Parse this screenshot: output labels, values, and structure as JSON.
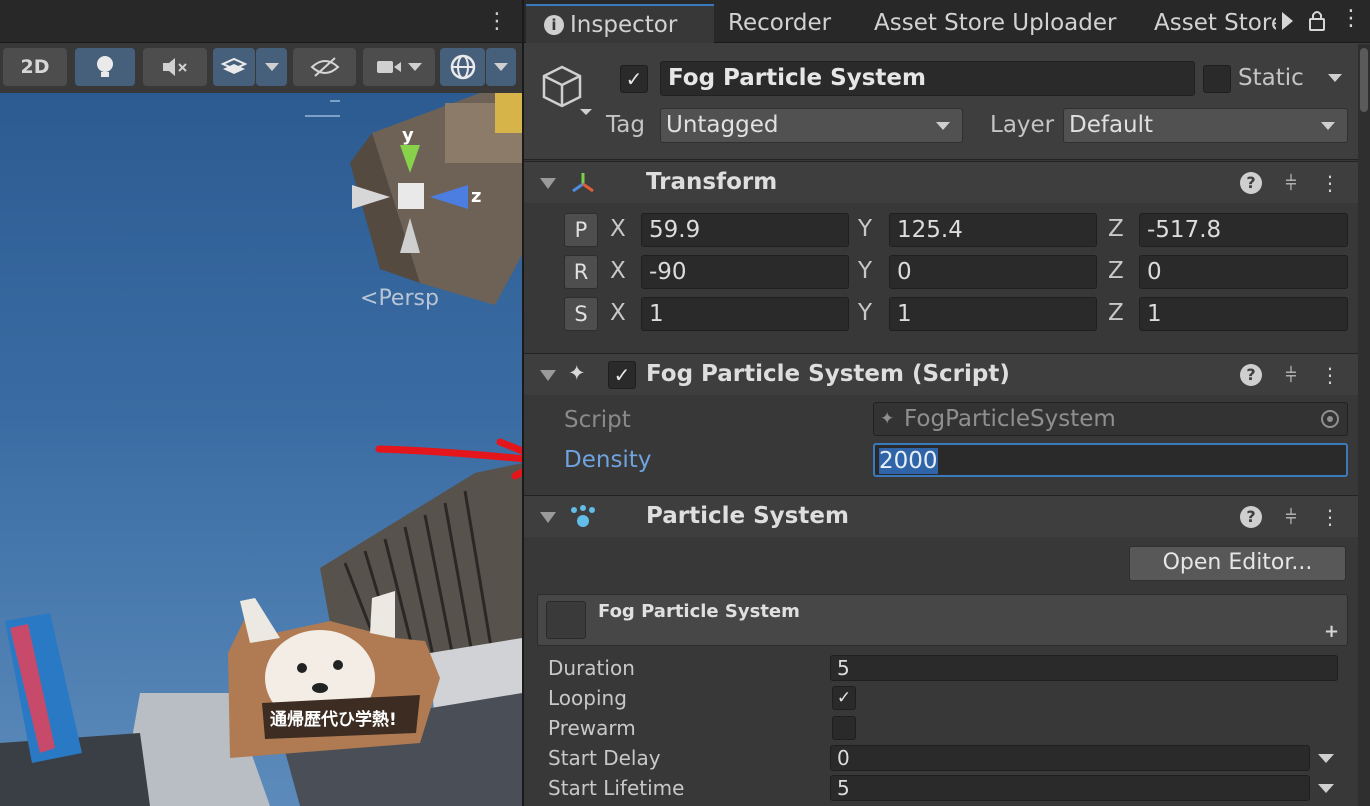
{
  "scene": {
    "toolbar": {
      "toggle_2d_label": "2D",
      "buttons": [
        "lighting-icon",
        "audio-mute-icon",
        "effects-icon",
        "visibility-icon",
        "camera-icon",
        "gizmos-icon"
      ]
    },
    "gizmo_axes": {
      "y": "y",
      "z": "z"
    },
    "perspective_label": "Persp",
    "billboard_text": "通帰歴代ひ学熱!"
  },
  "inspector": {
    "tabs": [
      {
        "label": "Inspector",
        "active": true
      },
      {
        "label": "Recorder"
      },
      {
        "label": "Asset Store Uploader"
      },
      {
        "label": "Asset Store"
      }
    ],
    "gameobject": {
      "active": true,
      "name": "Fog Particle System",
      "static_label": "Static",
      "tag_label": "Tag",
      "tag_value": "Untagged",
      "layer_label": "Layer",
      "layer_value": "Default"
    },
    "transform": {
      "title": "Transform",
      "position": {
        "button": "P",
        "x": "59.9",
        "y": "125.4",
        "z": "-517.8"
      },
      "rotation": {
        "button": "R",
        "x": "-90",
        "y": "0",
        "z": "0"
      },
      "scale": {
        "button": "S",
        "x": "1",
        "y": "1",
        "z": "1"
      },
      "axis_labels": {
        "x": "X",
        "y": "Y",
        "z": "Z"
      }
    },
    "script_component": {
      "title": "Fog Particle System (Script)",
      "enabled": true,
      "script_label": "Script",
      "script_value": "FogParticleSystem",
      "density_label": "Density",
      "density_value": "2000"
    },
    "particle_system": {
      "title": "Particle System",
      "open_editor_label": "Open Editor...",
      "module_title": "Fog Particle System",
      "fields": {
        "duration_label": "Duration",
        "duration_value": "5",
        "looping_label": "Looping",
        "looping_checked": true,
        "prewarm_label": "Prewarm",
        "prewarm_checked": false,
        "start_delay_label": "Start Delay",
        "start_delay_value": "0",
        "start_lifetime_label": "Start Lifetime",
        "start_lifetime_value": "5"
      }
    }
  },
  "colors": {
    "inspector_bg": "#383838",
    "header_bg": "#3e3e3e",
    "field_bg": "#2a2a2a",
    "accent_blue": "#3a79bb",
    "density_label": "#6fa3e0",
    "annotation_arrow": "#e4161b",
    "sky": "#2c5b91"
  }
}
